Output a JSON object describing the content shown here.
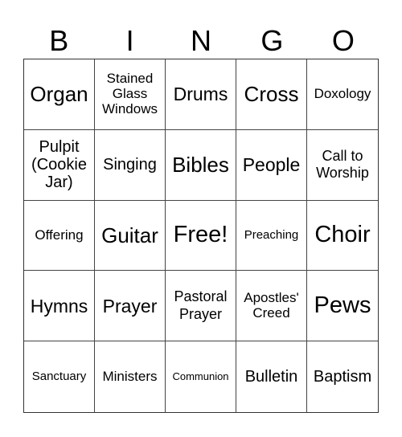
{
  "header": [
    "B",
    "I",
    "N",
    "G",
    "O"
  ],
  "cells": [
    {
      "text": "Organ",
      "size": "s-l"
    },
    {
      "text": "Stained Glass Windows",
      "size": "s-xs"
    },
    {
      "text": "Drums",
      "size": "s-m"
    },
    {
      "text": "Cross",
      "size": "s-l"
    },
    {
      "text": "Doxology",
      "size": "s-xs"
    },
    {
      "text": "Pulpit (Cookie Jar)",
      "size": "s-ml"
    },
    {
      "text": "Singing",
      "size": "s-ml"
    },
    {
      "text": "Bibles",
      "size": "s-l"
    },
    {
      "text": "People",
      "size": "s-m"
    },
    {
      "text": "Call to Worship",
      "size": "s-s"
    },
    {
      "text": "Offering",
      "size": "s-xs"
    },
    {
      "text": "Guitar",
      "size": "s-l"
    },
    {
      "text": "Free!",
      "size": "s-xl"
    },
    {
      "text": "Preaching",
      "size": "s-xxs"
    },
    {
      "text": "Choir",
      "size": "s-xl"
    },
    {
      "text": "Hymns",
      "size": "s-m"
    },
    {
      "text": "Prayer",
      "size": "s-m"
    },
    {
      "text": "Pastoral Prayer",
      "size": "s-s"
    },
    {
      "text": "Apostles' Creed",
      "size": "s-xs"
    },
    {
      "text": "Pews",
      "size": "s-xl"
    },
    {
      "text": "Sanctuary",
      "size": "s-xxs"
    },
    {
      "text": "Ministers",
      "size": "s-xs"
    },
    {
      "text": "Communion",
      "size": "s-tiny"
    },
    {
      "text": "Bulletin",
      "size": "s-ml"
    },
    {
      "text": "Baptism",
      "size": "s-ml"
    }
  ]
}
